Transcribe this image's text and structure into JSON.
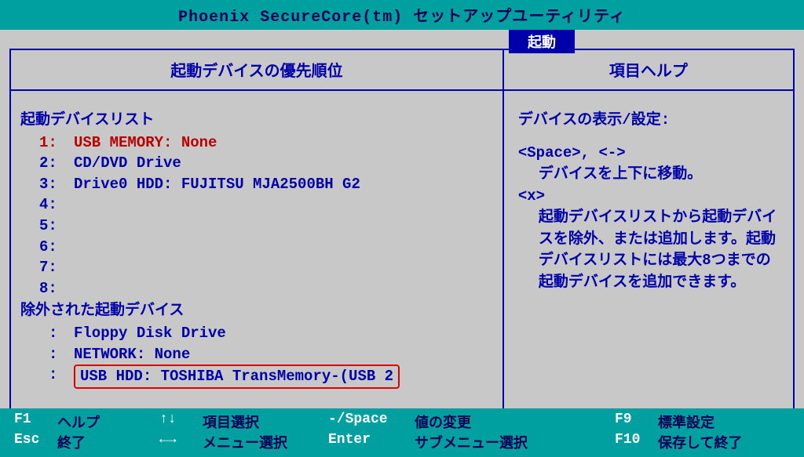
{
  "title": "Phoenix SecureCore(tm) セットアップユーティリティ",
  "active_tab": "起動",
  "left": {
    "header": "起動デバイスの優先順位",
    "list_title": "起動デバイスリスト",
    "items": [
      {
        "num": "1:",
        "label": "USB MEMORY: None",
        "selected": true
      },
      {
        "num": "2:",
        "label": "CD/DVD Drive",
        "selected": false
      },
      {
        "num": "3:",
        "label": "Drive0 HDD: FUJITSU MJA2500BH G2",
        "selected": false
      },
      {
        "num": "4:",
        "label": "",
        "selected": false
      },
      {
        "num": "5:",
        "label": "",
        "selected": false
      },
      {
        "num": "6:",
        "label": "",
        "selected": false
      },
      {
        "num": "7:",
        "label": "",
        "selected": false
      },
      {
        "num": "8:",
        "label": "",
        "selected": false
      }
    ],
    "excluded_title": "除外された起動デバイス",
    "excluded": [
      {
        "label": "Floppy Disk Drive"
      },
      {
        "label": "NETWORK: None"
      },
      {
        "label": "USB HDD: TOSHIBA TransMemory-(USB 2",
        "highlighted": true
      }
    ]
  },
  "right": {
    "header": "項目ヘルプ",
    "help_title": "デバイスの表示/設定:",
    "help_key1": "<Space>, <->",
    "help_text1": "デバイスを上下に移動。",
    "help_key2": "<x>",
    "help_text2": "起動デバイスリストから起動デバイスを除外、または追加します。起動デバイスリストには最大8つまでの起動デバイスを追加できます。"
  },
  "footer": {
    "row1": [
      {
        "key": "F1",
        "label": "ヘルプ",
        "kw": 55,
        "lw": 130
      },
      {
        "key": "↑↓",
        "label": "項目選択",
        "kw": 55,
        "lw": 160
      },
      {
        "key": "-/Space",
        "label": "値の変更",
        "kw": 110,
        "lw": 255
      },
      {
        "key": "F9",
        "label": "標準設定",
        "kw": 55,
        "lw": 150
      }
    ],
    "row2": [
      {
        "key": "Esc",
        "label": "終了",
        "kw": 55,
        "lw": 130
      },
      {
        "key": "←→",
        "label": "メニュー選択",
        "kw": 55,
        "lw": 160
      },
      {
        "key": "Enter",
        "label": "サブメニュー選択",
        "kw": 110,
        "lw": 255
      },
      {
        "key": "F10",
        "label": "保存して終了",
        "kw": 55,
        "lw": 150
      }
    ]
  }
}
